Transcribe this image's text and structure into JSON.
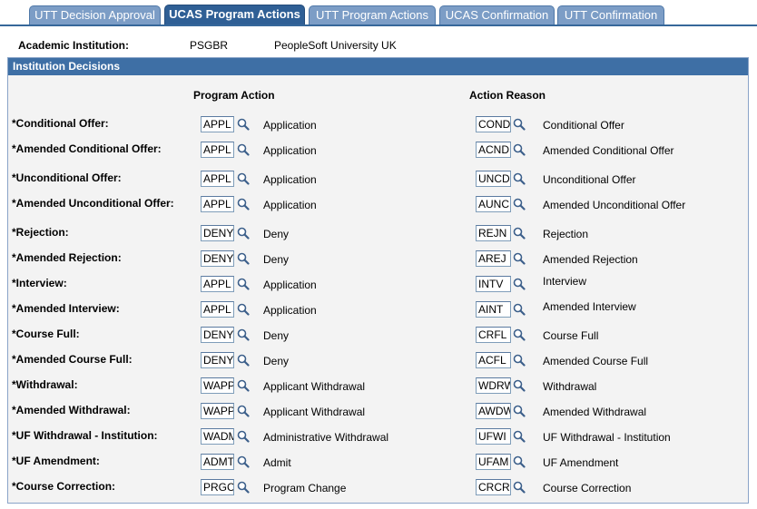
{
  "tabs": [
    {
      "label": "UTT Decision Approval",
      "active": false
    },
    {
      "label": "UCAS Program Actions",
      "active": true
    },
    {
      "label": "UTT Program Actions",
      "active": false
    },
    {
      "label": "UCAS Confirmation",
      "active": false
    },
    {
      "label": "UTT Confirmation",
      "active": false
    }
  ],
  "institution": {
    "label": "Academic Institution:",
    "code": "PSGBR",
    "name": "PeopleSoft University UK"
  },
  "section": {
    "title": "Institution Decisions",
    "program_action_header": "Program Action",
    "action_reason_header": "Action Reason"
  },
  "rows": [
    {
      "label": "*Conditional Offer:",
      "pa_code": "APPL",
      "pa_desc": "Application",
      "ar_code": "COND",
      "ar_desc": "Conditional Offer"
    },
    {
      "label": "*Amended Conditional Offer:",
      "pa_code": "APPL",
      "pa_desc": "Application",
      "ar_code": "ACND",
      "ar_desc": "Amended Conditional Offer"
    },
    {
      "label": "*Unconditional Offer:",
      "pa_code": "APPL",
      "pa_desc": "Application",
      "ar_code": "UNCD",
      "ar_desc": "Unconditional Offer"
    },
    {
      "label": "*Amended Unconditional Offer:",
      "pa_code": "APPL",
      "pa_desc": "Application",
      "ar_code": "AUNC",
      "ar_desc": "Amended Unconditional Offer"
    },
    {
      "label": "*Rejection:",
      "pa_code": "DENY",
      "pa_desc": "Deny",
      "ar_code": "REJN",
      "ar_desc": "Rejection"
    },
    {
      "label": "*Amended Rejection:",
      "pa_code": "DENY",
      "pa_desc": "Deny",
      "ar_code": "AREJ",
      "ar_desc": "Amended Rejection"
    },
    {
      "label": "*Interview:",
      "pa_code": "APPL",
      "pa_desc": "Application",
      "ar_code": "INTV",
      "ar_desc": "Interview"
    },
    {
      "label": "*Amended Interview:",
      "pa_code": "APPL",
      "pa_desc": "Application",
      "ar_code": "AINT",
      "ar_desc": "Amended Interview"
    },
    {
      "label": "*Course Full:",
      "pa_code": "DENY",
      "pa_desc": "Deny",
      "ar_code": "CRFL",
      "ar_desc": "Course Full"
    },
    {
      "label": "*Amended Course Full:",
      "pa_code": "DENY",
      "pa_desc": "Deny",
      "ar_code": "ACFL",
      "ar_desc": "Amended Course Full"
    },
    {
      "label": "*Withdrawal:",
      "pa_code": "WAPP",
      "pa_desc": "Applicant Withdrawal",
      "ar_code": "WDRW",
      "ar_desc": "Withdrawal"
    },
    {
      "label": "*Amended Withdrawal:",
      "pa_code": "WAPP",
      "pa_desc": "Applicant Withdrawal",
      "ar_code": "AWDW",
      "ar_desc": "Amended Withdrawal"
    },
    {
      "label": "*UF Withdrawal - Institution:",
      "pa_code": "WADM",
      "pa_desc": "Administrative Withdrawal",
      "ar_code": "UFWI",
      "ar_desc": "UF Withdrawal - Institution"
    },
    {
      "label": "*UF Amendment:",
      "pa_code": "ADMT",
      "pa_desc": "Admit",
      "ar_code": "UFAM",
      "ar_desc": "UF Amendment"
    },
    {
      "label": "*Course Correction:",
      "pa_code": "PRGC",
      "pa_desc": "Program Change",
      "ar_code": "CRCR",
      "ar_desc": "Course Correction"
    }
  ],
  "icons": {
    "lookup": "magnifier-lookup-icon"
  },
  "colors": {
    "tab": "#7c9dc6",
    "tab_active": "#2f5f95",
    "section_header": "#3e6fa5",
    "section_bg": "#f3f3f3"
  }
}
